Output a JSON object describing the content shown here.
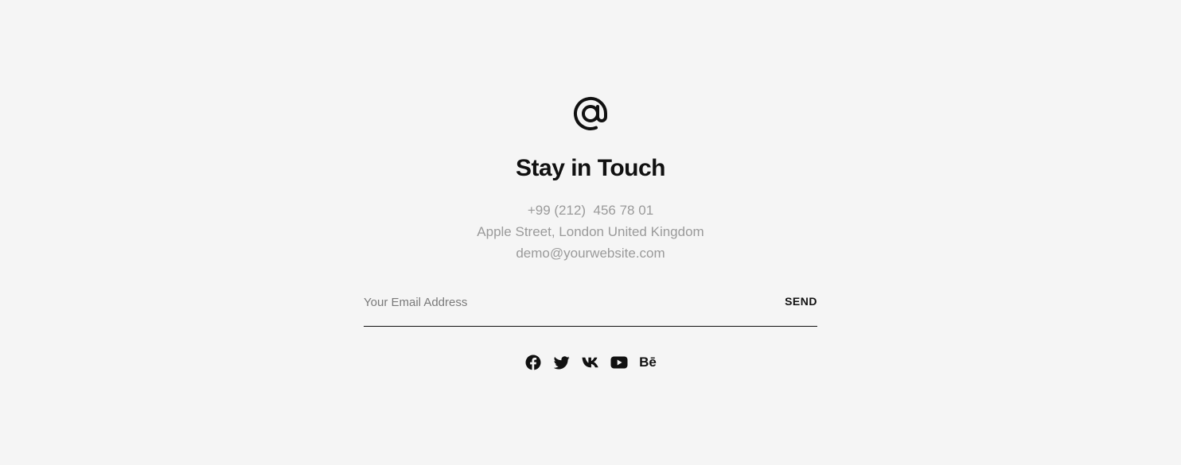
{
  "contact": {
    "title": "Stay in Touch",
    "phone": "+99 (212)  456 78 01",
    "address": "Apple Street, London United Kingdom",
    "email": "demo@yourwebsite.com"
  },
  "subscribe": {
    "placeholder": "Your Email Address",
    "value": "",
    "button_label": "SEND"
  },
  "social": {
    "behance_label": "Bē",
    "icons": [
      "facebook-icon",
      "twitter-icon",
      "vk-icon",
      "youtube-icon",
      "behance-icon"
    ]
  },
  "colors": {
    "background": "#f5f5f5",
    "text_primary": "#111111",
    "text_muted": "#9a9a9a",
    "placeholder": "#7a7a7a"
  }
}
